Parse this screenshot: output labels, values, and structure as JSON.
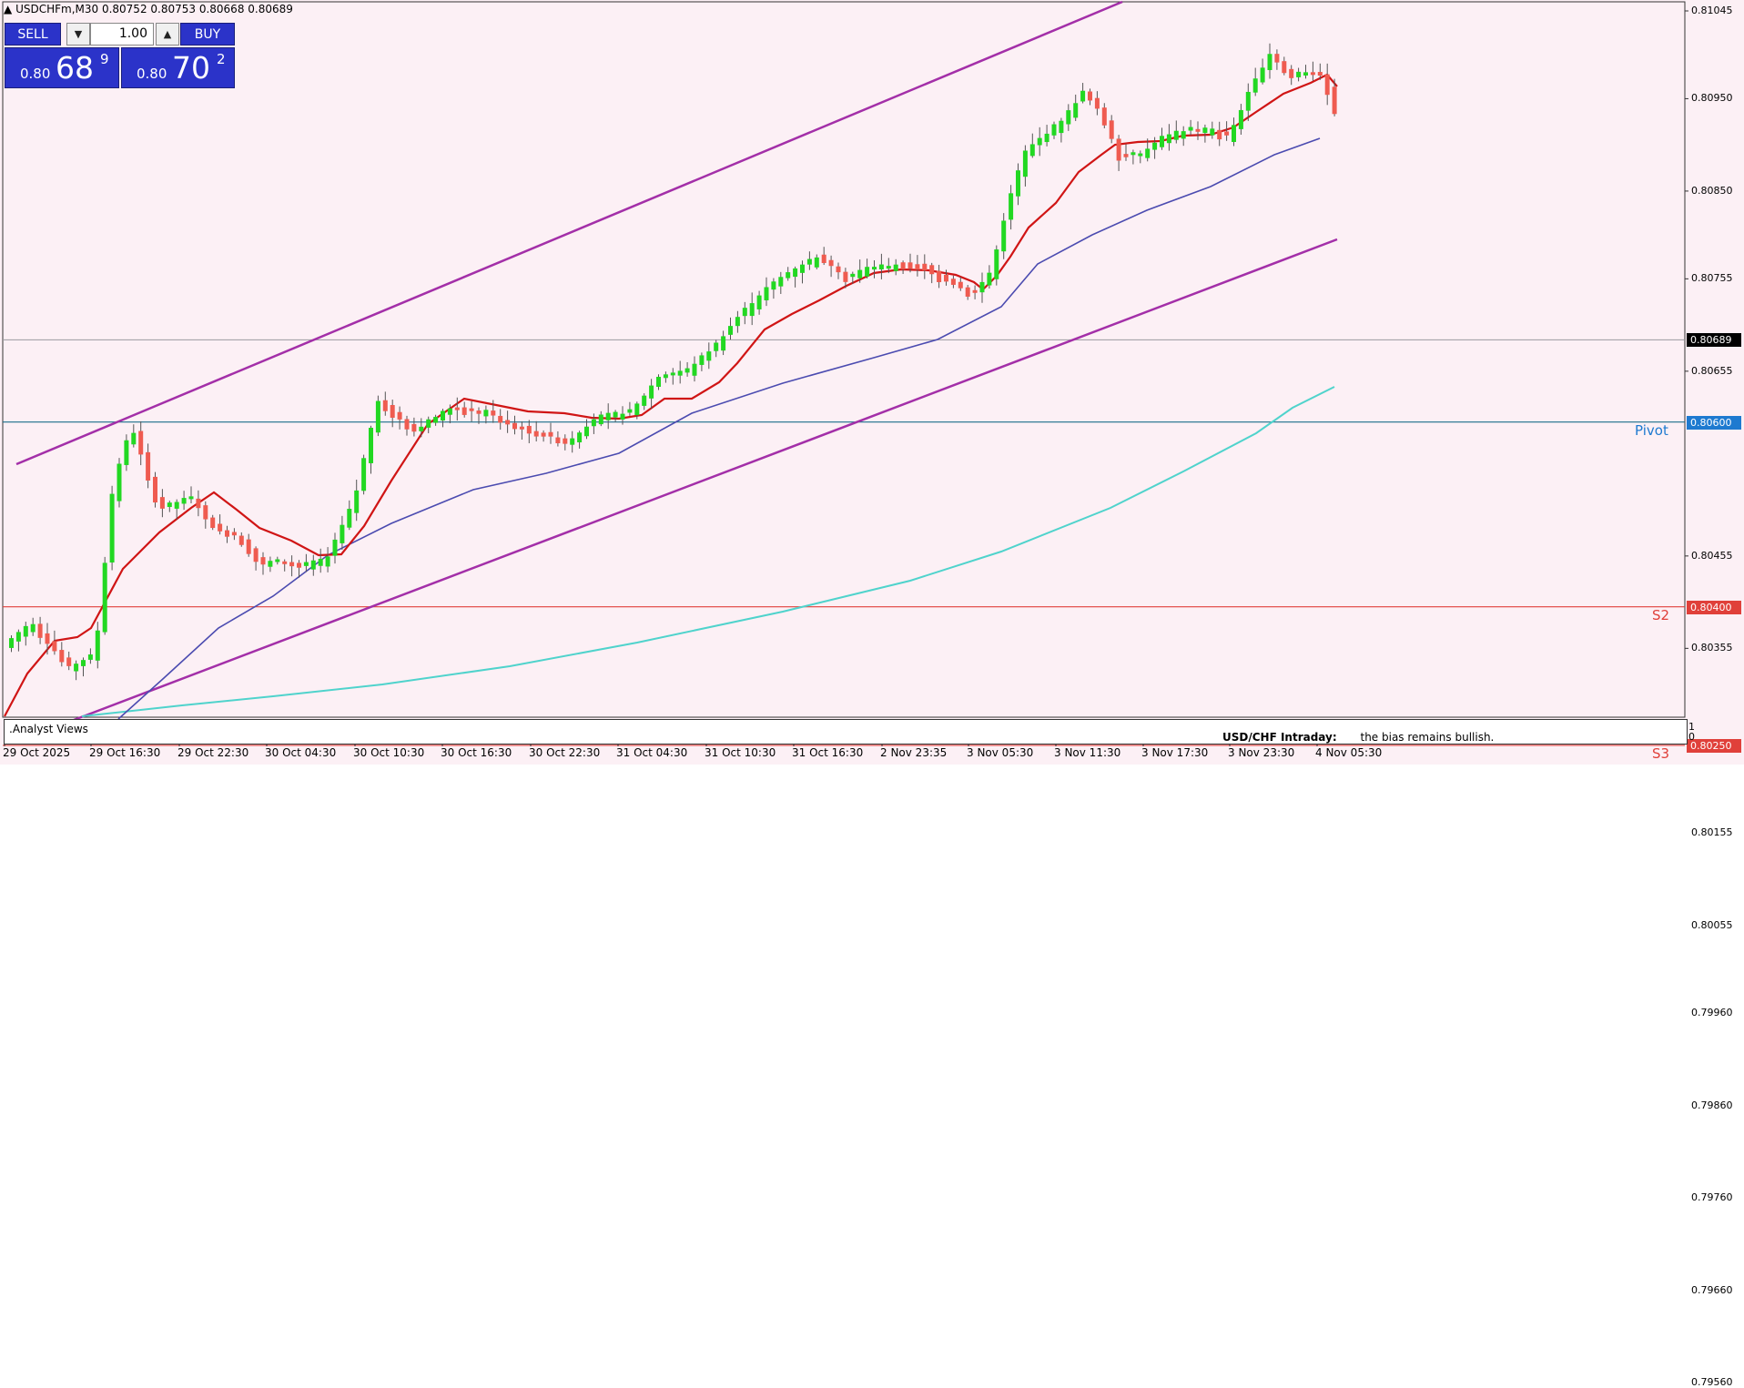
{
  "title_bar": {
    "symbol_info": "USDCHFm,M30  0.80752 0.80753 0.80668 0.80689"
  },
  "trade_panel": {
    "sell_label": "SELL",
    "buy_label": "BUY",
    "lots": "1.00",
    "sell_price": {
      "prefix": "0.80",
      "big": "68",
      "sup": "9"
    },
    "buy_price": {
      "prefix": "0.80",
      "big": "70",
      "sup": "2"
    }
  },
  "price_axis": {
    "labels": [
      "0.81045",
      "0.80950",
      "0.80850",
      "0.80755",
      "0.80655",
      "0.80455",
      "0.80355",
      "0.80155",
      "0.80055",
      "0.79960",
      "0.79860",
      "0.79760",
      "0.79660",
      "0.79560"
    ],
    "current_price": "0.80689"
  },
  "levels": [
    {
      "name": "Pivot",
      "price": 0.806,
      "tag": "0.80600",
      "color": "#1e7ad0"
    },
    {
      "name": "S2",
      "price": 0.804,
      "tag": "0.80400",
      "color": "#e0403a"
    },
    {
      "name": "S3",
      "price": 0.8025,
      "tag": "0.80250",
      "color": "#e0403a"
    }
  ],
  "time_axis": [
    "29 Oct 2025",
    "29 Oct 16:30",
    "29 Oct 22:30",
    "30 Oct 04:30",
    "30 Oct 10:30",
    "30 Oct 16:30",
    "30 Oct 22:30",
    "31 Oct 04:30",
    "31 Oct 10:30",
    "31 Oct 16:30",
    "2 Nov 23:35",
    "3 Nov 05:30",
    "3 Nov 11:30",
    "3 Nov 17:30",
    "3 Nov 23:30",
    "4 Nov 05:30"
  ],
  "bottom_panel": {
    "label": ".Analyst Views",
    "note_title": "USD/CHF Intraday:",
    "note_text": "the bias remains bullish.",
    "scale_top": "1",
    "scale_bottom": "0"
  },
  "chart_data": {
    "type": "candlestick",
    "symbol": "USDCHFm",
    "timeframe": "M30",
    "ylim": [
      0.7952,
      0.8106
    ],
    "trend": "upward channel, bullish",
    "colors": {
      "up": "#22d822",
      "down": "#ef5b50",
      "channel": "#a32fa8",
      "ma_fast": "#d01515",
      "ma_mid": "#4b4bb0",
      "ma_slow": "#4fd3cc"
    }
  }
}
